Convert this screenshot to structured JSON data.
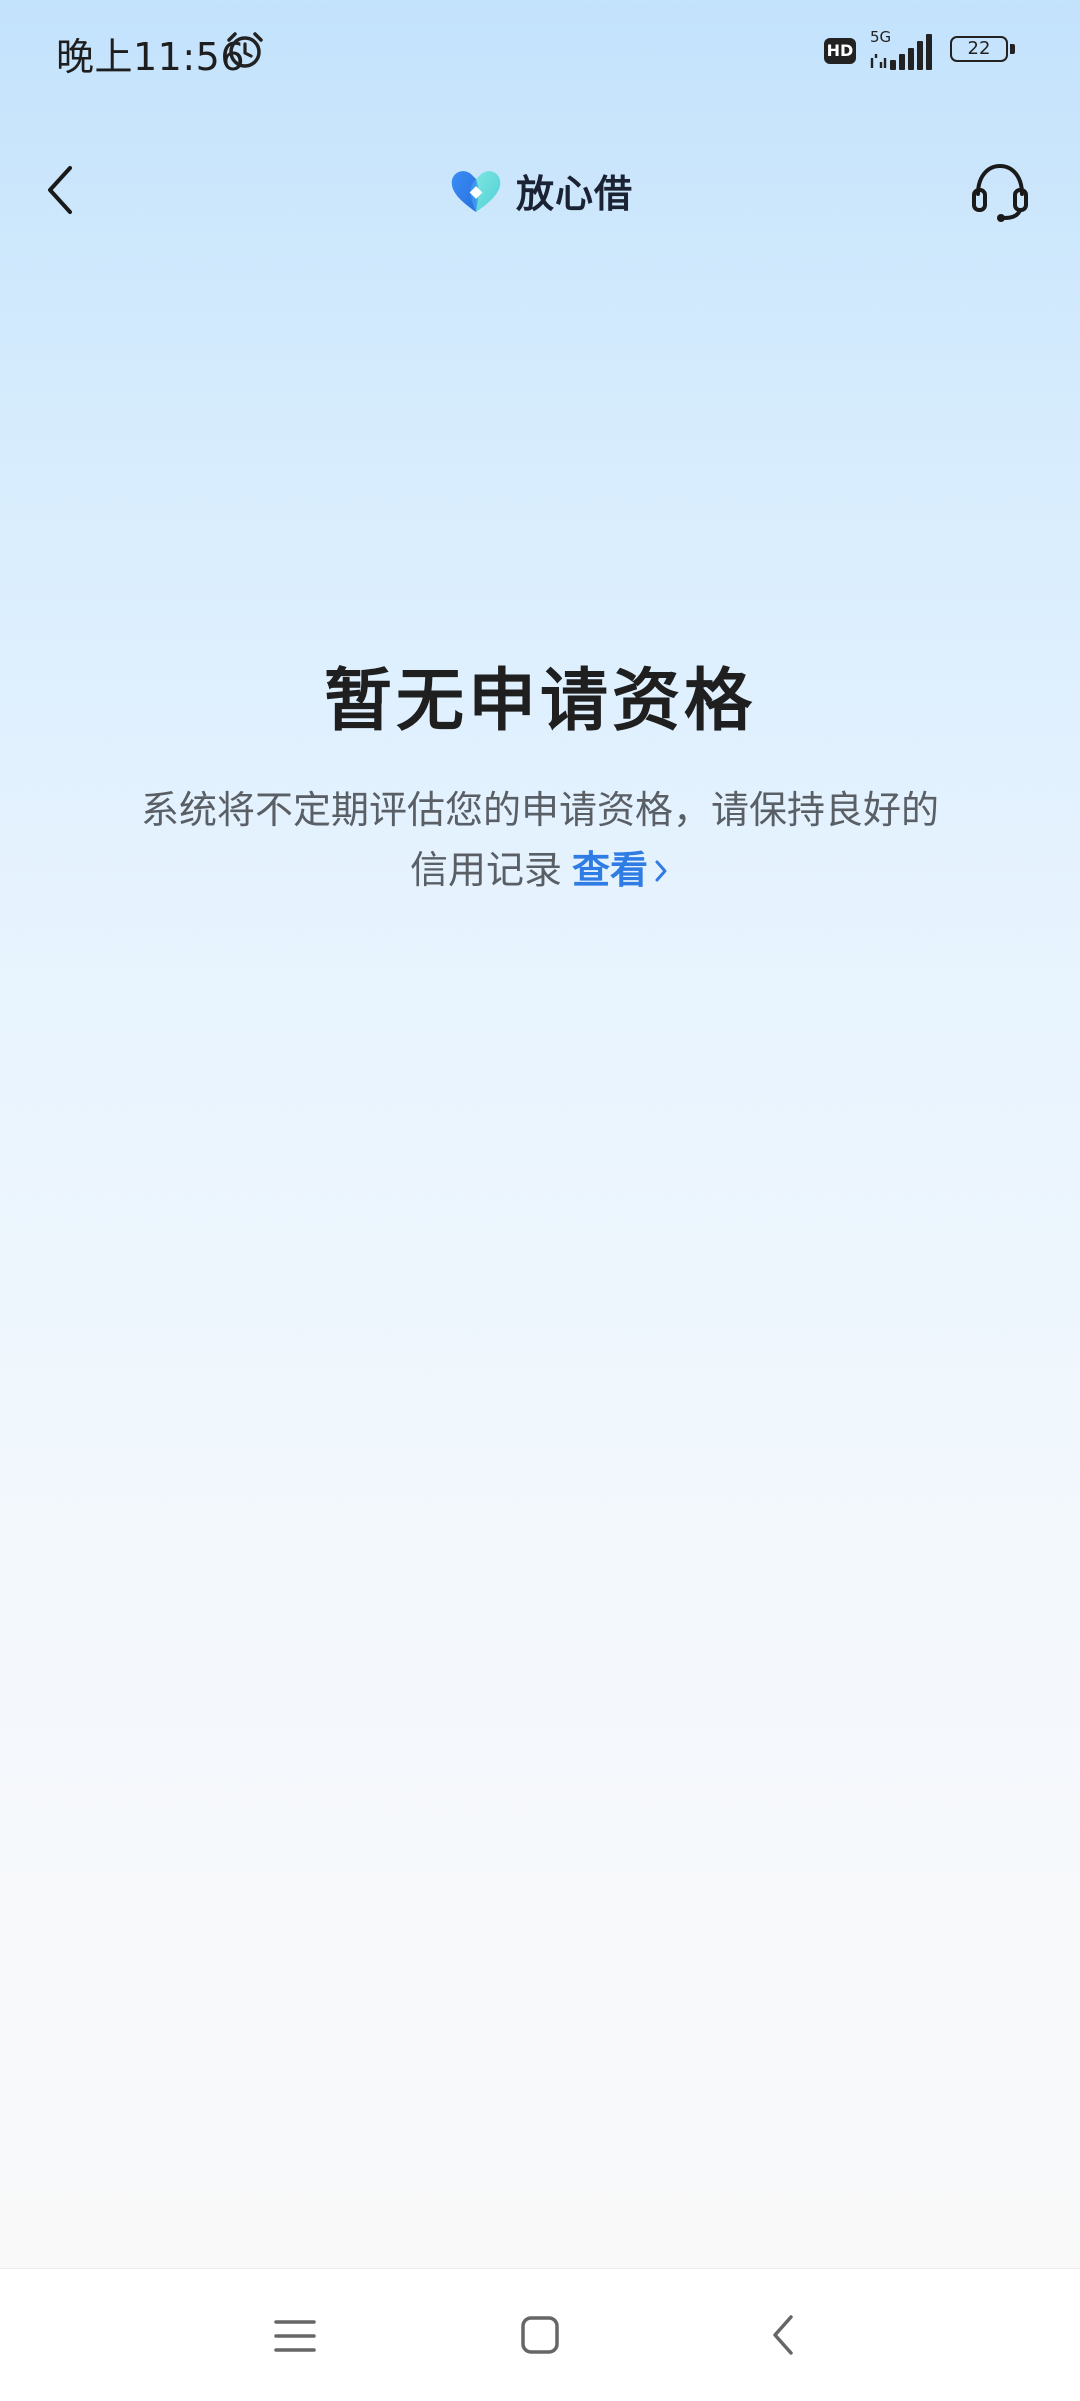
{
  "status_bar": {
    "time": "晚上11:56",
    "network_type": "5G",
    "hd_badge": "HD",
    "battery_level": "22",
    "icons": [
      "alarm-icon",
      "hd-icon",
      "signal-icon",
      "battery-icon"
    ]
  },
  "header": {
    "brand_name": "放心借",
    "icons": [
      "back-chevron-icon",
      "brand-heart-logo",
      "headset-icon"
    ]
  },
  "main": {
    "title": "暂无申请资格",
    "description": "系统将不定期评估您的申请资格，请保持良好的信用记录",
    "view_link": "查看"
  },
  "system_nav": {
    "icons": [
      "menu-icon",
      "home-icon",
      "back-icon"
    ]
  },
  "colors": {
    "accent": "#2f7ce5",
    "title_text": "#1f1f1f",
    "body_text": "#5a5f66",
    "background_top": "#c3e2fc",
    "background_bottom": "#f9f9f9"
  }
}
